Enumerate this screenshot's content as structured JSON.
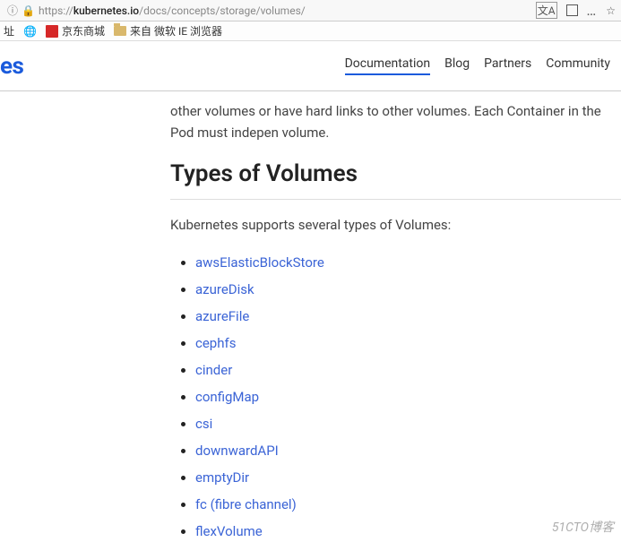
{
  "urlbar": {
    "scheme": "https://",
    "host": "kubernetes.io",
    "path": "/docs/concepts/storage/volumes/"
  },
  "bookmarks": {
    "item1": "址",
    "item2": "京东商城",
    "item3": "来自 微软 IE 浏览器"
  },
  "logo_fragment": "es",
  "nav": {
    "documentation": "Documentation",
    "blog": "Blog",
    "partners": "Partners",
    "community": "Community"
  },
  "body": {
    "para_frag": "other volumes or have hard links to other volumes. Each Container in the Pod must indepen volume.",
    "heading": "Types of Volumes",
    "subtext": "Kubernetes supports several types of Volumes:",
    "volumes": [
      "awsElasticBlockStore",
      "azureDisk",
      "azureFile",
      "cephfs",
      "cinder",
      "configMap",
      "csi",
      "downwardAPI",
      "emptyDir",
      "fc (fibre channel)",
      "flexVolume"
    ]
  },
  "watermark": "51CTO博客"
}
